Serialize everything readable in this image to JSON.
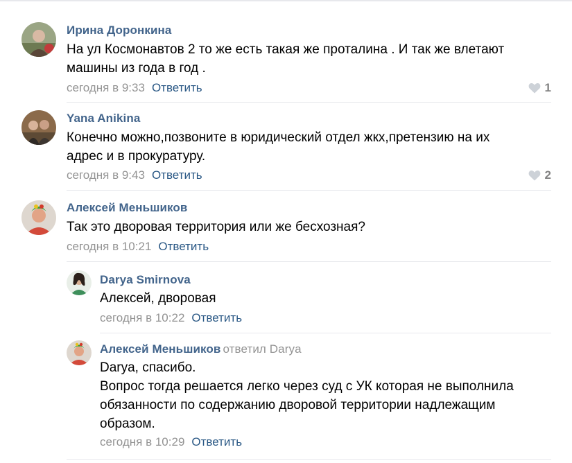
{
  "comments": [
    {
      "author": "Ирина Доронкина",
      "text": [
        "На ул Космонавтов 2 то же есть такая же проталина . И так же влетают",
        "машины из года в год ."
      ],
      "time": "сегодня в 9:33",
      "reply_label": "Ответить",
      "likes": "1"
    },
    {
      "author": "Yana Anikina",
      "text": [
        "Конечно можно,позвоните в юридический отдел жкх,претензию на их",
        "адрес и в прокуратуру."
      ],
      "time": "сегодня в 9:43",
      "reply_label": "Ответить",
      "likes": "2"
    },
    {
      "author": "Алексей Меньшиков",
      "text": [
        "Так это дворовая территория или же бесхозная?"
      ],
      "time": "сегодня в 10:21",
      "reply_label": "Ответить"
    }
  ],
  "replies": [
    {
      "author": "Darya Smirnova",
      "text": [
        "Алексей, дворовая"
      ],
      "time": "сегодня в 10:22",
      "reply_label": "Ответить"
    },
    {
      "author": "Алексей Меньшиков",
      "reply_to": "ответил Darya",
      "text": [
        "Darya, спасибо.",
        "Вопрос тогда решается легко через суд с УК которая не выполнила",
        "обязанности по содержанию дворовой территории надлежащим",
        "образом."
      ],
      "time": "сегодня в 10:29",
      "reply_label": "Ответить"
    }
  ],
  "colors": {
    "author": "#42648b",
    "link": "#2a5885",
    "meta": "#939393",
    "separator": "#e7e8ec",
    "like_icon": "#cdd2d8"
  }
}
